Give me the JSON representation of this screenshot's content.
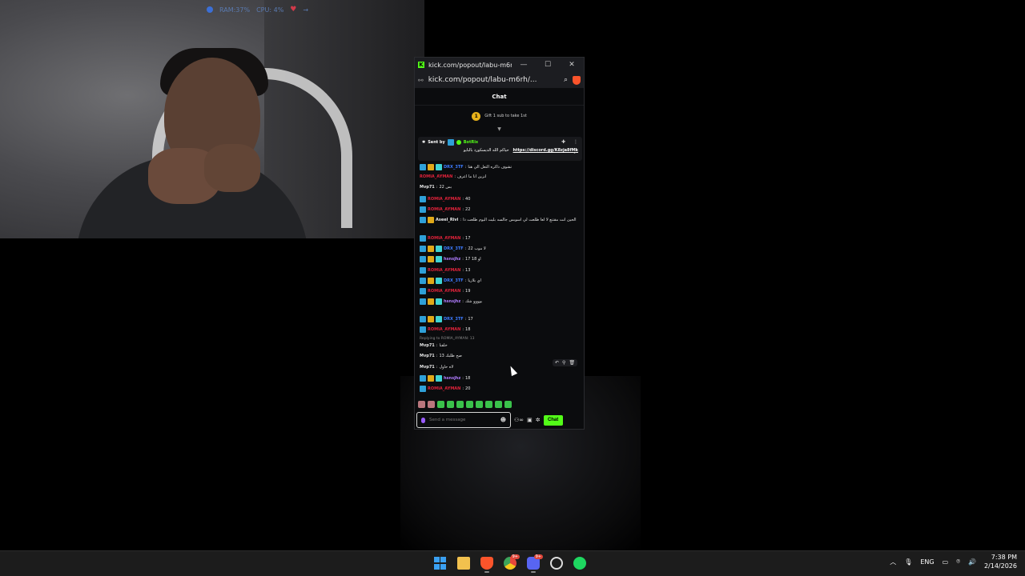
{
  "overlay": {
    "ram": "RAM:37%",
    "cpu": "CPU: 4%"
  },
  "window": {
    "title": "kick.com/popout/labu-m6r...",
    "url": "kick.com/popout/labu-m6rh/...",
    "minimize": "—",
    "maximize": "☐",
    "close": "✕"
  },
  "chat": {
    "header": "Chat",
    "gift_badge": "1",
    "gift_text": "Gift 1 sub to take 1st",
    "pinned": {
      "sent_by_prefix": "Sent by",
      "sender": "BotRix",
      "text": "حياكم الله الديسكورد بالبايو",
      "link": "https://discord.gg/K8zja8fMk"
    },
    "messages": [
      {
        "badges": [
          "og",
          "gold",
          "sub"
        ],
        "user": "DRX_3TF",
        "color": "blue",
        "text": "تشوف ذاكره التعل الي هنا"
      },
      {
        "badges": [],
        "user": "ROMIA_AYMAN",
        "color": "red",
        "text": "انزين انا ما اعرف"
      },
      {
        "badges": [],
        "user": "Mvp71",
        "color": "white",
        "text": "بس 22"
      },
      {
        "badges": [
          "og"
        ],
        "user": "ROMIA_AYMAN",
        "color": "red",
        "text": "40"
      },
      {
        "badges": [
          "og"
        ],
        "user": "ROMIA_AYMAN",
        "color": "red",
        "text": "22"
      },
      {
        "badges": [
          "og",
          "gold"
        ],
        "user": "Aseel_Rivi",
        "color": "white",
        "text": "الحين انت مقتنع لا لعا طلعت لي اسوبس جالسه بليت اليوم طلعت ذا"
      },
      {
        "badges": [
          "og"
        ],
        "user": "ROMIA_AYMAN",
        "color": "red",
        "text": "17"
      },
      {
        "badges": [
          "og",
          "gold",
          "sub"
        ],
        "user": "DRX_3TF",
        "color": "blue",
        "text": "لا موب 22"
      },
      {
        "badges": [
          "og",
          "gold",
          "sub"
        ],
        "user": "hsnsjhz",
        "color": "purple",
        "text": "17 او 18"
      },
      {
        "badges": [
          "og"
        ],
        "user": "ROMIA_AYMAN",
        "color": "red",
        "text": "13"
      },
      {
        "badges": [
          "og",
          "gold",
          "sub"
        ],
        "user": "DRX_3TF",
        "color": "blue",
        "text": "اي بلازيا"
      },
      {
        "badges": [
          "og"
        ],
        "user": "ROMIA_AYMAN",
        "color": "red",
        "text": "19"
      },
      {
        "badges": [
          "og",
          "gold",
          "sub"
        ],
        "user": "hsnsjhz",
        "color": "purple",
        "text": "بوووو شك"
      },
      {
        "badges": [
          "og",
          "gold",
          "sub"
        ],
        "user": "DRX_3TF",
        "color": "blue",
        "text": "17"
      },
      {
        "badges": [
          "og"
        ],
        "user": "ROMIA_AYMAN",
        "color": "red",
        "text": "18"
      },
      {
        "badges": [],
        "user": "Mvp71",
        "color": "white",
        "text": "خلقنا"
      },
      {
        "badges": [],
        "user": "Mvp71",
        "color": "white",
        "text": "صح ظلبك 13"
      },
      {
        "badges": [],
        "user": "Mvp71",
        "color": "white",
        "text": "لاه حاول"
      },
      {
        "badges": [
          "og",
          "gold",
          "sub"
        ],
        "user": "hsnsjhz",
        "color": "purple",
        "text": "18"
      },
      {
        "badges": [
          "og"
        ],
        "user": "ROMIA_AYMAN",
        "color": "red",
        "text": "20"
      }
    ],
    "reply_hint": "Replying to ROMIA_AYMAN: 13",
    "input_placeholder": "Send a message",
    "send_label": "Chat"
  },
  "taskbar": {
    "badge_chrome": "9+",
    "badge_discord": "9+",
    "lang": "ENG",
    "time": "7:38 PM",
    "date": "2/14/2026"
  }
}
